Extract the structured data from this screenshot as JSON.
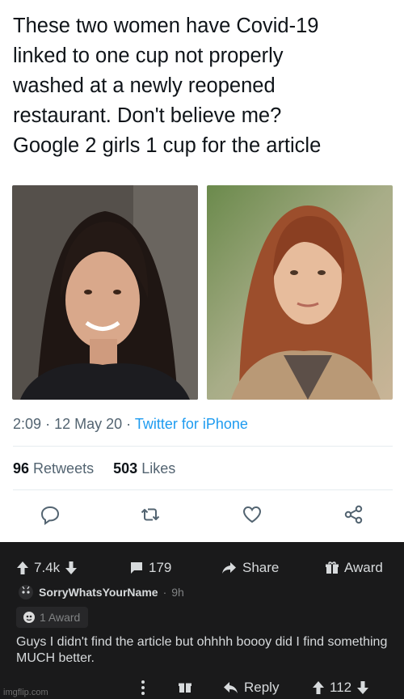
{
  "tweet": {
    "text_lines": [
      "These two women have Covid-19",
      "linked to one cup not properly",
      "washed at a newly reopened",
      "restaurant. Don't believe me?",
      "Google 2 girls 1 cup for the article"
    ],
    "time": "2:09",
    "date": "12 May 20",
    "source": "Twitter for iPhone",
    "retweets_count": "96",
    "retweets_label": "Retweets",
    "likes_count": "503",
    "likes_label": "Likes",
    "colors": {
      "text": "#0f1419",
      "muted": "#536471",
      "link": "#1d9bf0"
    },
    "action_icons": [
      "reply-icon",
      "retweet-icon",
      "like-icon",
      "share-icon"
    ]
  },
  "reddit": {
    "upvotes": "7.4k",
    "comments": "179",
    "share_label": "Share",
    "award_label": "Award",
    "username": "SorryWhatsYourName",
    "time_ago": "9h",
    "award_chip": "1 Award",
    "comment_text": "Guys I didn't find the article but ohhhh boooy did I find something MUCH better.",
    "reply_label": "Reply",
    "comment_score": "112",
    "watermark": "imgflip.com",
    "colors": {
      "background": "#1a1a1b",
      "text": "#d7dadc",
      "muted": "#818384"
    }
  }
}
